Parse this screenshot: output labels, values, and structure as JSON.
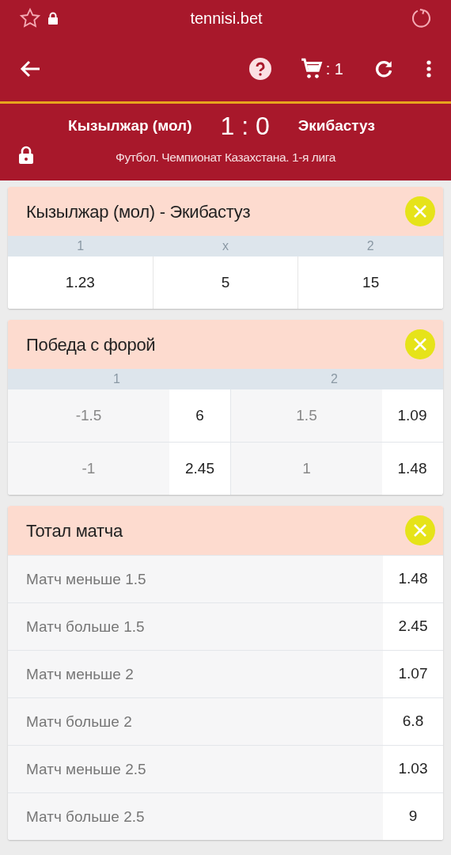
{
  "browser": {
    "url": "tennisi.bet"
  },
  "toolbar": {
    "cart_count": ": 1"
  },
  "match": {
    "home": "Кызылжар (мол)",
    "score": "1 : 0",
    "away": "Экибастуз",
    "league": "Футбол. Чемпионат Казахстана. 1-я лига",
    "locked": true
  },
  "markets": [
    {
      "kind": "three_way",
      "title": "Кызылжар (мол) - Экибастуз",
      "columns": [
        "1",
        "x",
        "2"
      ],
      "odds": [
        "1.23",
        "5",
        "15"
      ]
    },
    {
      "kind": "handicap",
      "title": "Победа с форой",
      "columns": [
        "1",
        "2"
      ],
      "rows": [
        {
          "h1": "-1.5",
          "o1": "6",
          "h2": "1.5",
          "o2": "1.09"
        },
        {
          "h1": "-1",
          "o1": "2.45",
          "h2": "1",
          "o2": "1.48"
        }
      ]
    },
    {
      "kind": "list",
      "title": "Тотал матча",
      "rows": [
        {
          "label": "Матч меньше 1.5",
          "odds": "1.48"
        },
        {
          "label": "Матч больше 1.5",
          "odds": "2.45"
        },
        {
          "label": "Матч меньше 2",
          "odds": "1.07"
        },
        {
          "label": "Матч больше 2",
          "odds": "6.8"
        },
        {
          "label": "Матч меньше 2.5",
          "odds": "1.03"
        },
        {
          "label": "Матч больше 2.5",
          "odds": "9"
        }
      ]
    }
  ]
}
